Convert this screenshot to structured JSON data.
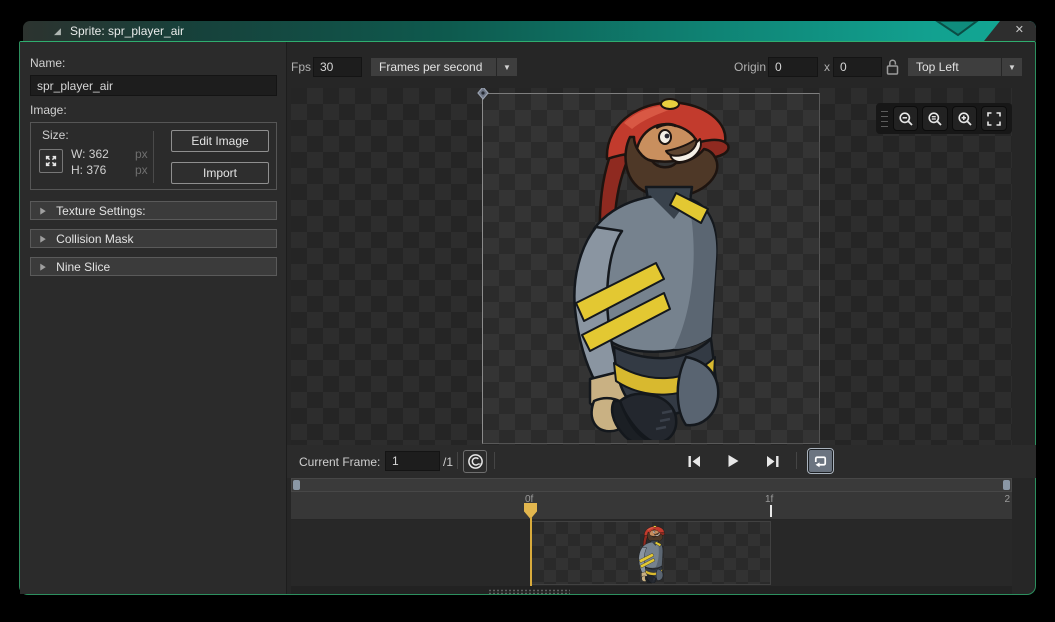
{
  "window": {
    "title": "Sprite: spr_player_air"
  },
  "icons": {
    "collapse_corner": "◢",
    "close": "✕",
    "dropdown_arrow": "▼",
    "accordion_arrow": "▶"
  },
  "left_panel": {
    "name_label": "Name:",
    "name_value": "spr_player_air",
    "image_label": "Image:",
    "size": {
      "label": "Size:",
      "width_label": "W: 362",
      "height_label": "H: 376",
      "width_unit": "px",
      "height_unit": "px"
    },
    "edit_image_button": "Edit Image",
    "import_button": "Import",
    "sections": [
      {
        "label": "Texture Settings:"
      },
      {
        "label": "Collision Mask"
      },
      {
        "label": "Nine Slice"
      }
    ]
  },
  "toolbar": {
    "fps_label": "Fps",
    "fps_value": "30",
    "playback_mode": "Frames per second",
    "origin_label": "Origin",
    "origin_x": "0",
    "origin_separator": "x",
    "origin_y": "0",
    "origin_preset": "Top Left"
  },
  "frame_bar": {
    "current_frame_label": "Current Frame:",
    "current_frame_value": "1",
    "frame_total": "/1"
  },
  "timeline": {
    "ticks": [
      {
        "label": "0f"
      },
      {
        "label": "1f"
      },
      {
        "label": "2"
      }
    ]
  },
  "colors": {
    "titlebar_teal": "#12a190",
    "window_border_green": "#2c8f5e",
    "panel_bg": "#2b2b2b",
    "playhead_yellow": "#e2b64e",
    "loop_active_bg": "#6b7480",
    "scroll_handle": "#8a97a5",
    "stripe_yellow": "#e3c832",
    "helmet_red": "#c23b2d"
  }
}
